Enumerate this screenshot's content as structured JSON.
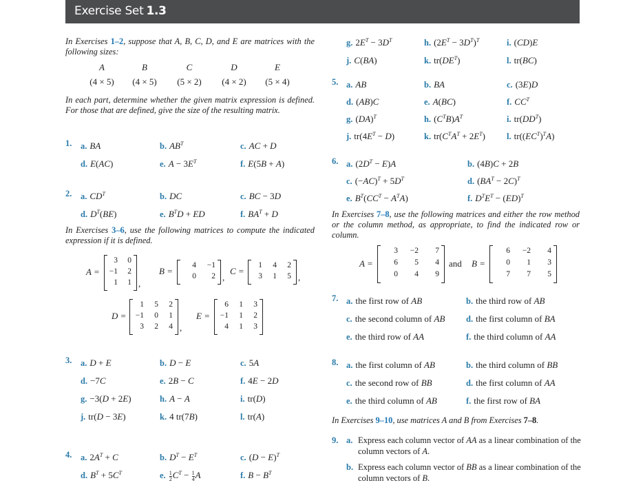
{
  "header": {
    "title": "Exercise Set",
    "number": "1.3"
  },
  "intro_1_2": {
    "prefix": "In Exercises ",
    "ref": "1–2",
    "suffix": ", suppose that A, B, C, D, and E are matrices with the following sizes:"
  },
  "sizes": [
    {
      "name": "A",
      "size": "(4 × 5)"
    },
    {
      "name": "B",
      "size": "(4 × 5)"
    },
    {
      "name": "C",
      "size": "(5 × 2)"
    },
    {
      "name": "D",
      "size": "(4 × 2)"
    },
    {
      "name": "E",
      "size": "(5 × 4)"
    }
  ],
  "instruction_1_2": "In each part, determine whether the given matrix expression is defined. For those that are defined, give the size of the resulting matrix.",
  "exercises": {
    "ex1": {
      "number": "1.",
      "parts": [
        {
          "label": "a.",
          "expr": "BA"
        },
        {
          "label": "b.",
          "expr": "AB^T"
        },
        {
          "label": "c.",
          "expr": "AC + D"
        },
        {
          "label": "d.",
          "expr": "E(AC)"
        },
        {
          "label": "e.",
          "expr": "A − 3E^T"
        },
        {
          "label": "f.",
          "expr": "E(5B + A)"
        }
      ]
    },
    "ex2": {
      "number": "2.",
      "parts": [
        {
          "label": "a.",
          "expr": "CD^T"
        },
        {
          "label": "b.",
          "expr": "DC"
        },
        {
          "label": "c.",
          "expr": "BC − 3D"
        },
        {
          "label": "d.",
          "expr": "D^T(BE)"
        },
        {
          "label": "e.",
          "expr": "B^TD + ED"
        },
        {
          "label": "f.",
          "expr": "BA^T + D"
        }
      ]
    },
    "ex3": {
      "number": "3.",
      "parts": [
        {
          "label": "a.",
          "expr": "D + E"
        },
        {
          "label": "b.",
          "expr": "D − E"
        },
        {
          "label": "c.",
          "expr": "5A"
        },
        {
          "label": "d.",
          "expr": "−7C"
        },
        {
          "label": "e.",
          "expr": "2B − C"
        },
        {
          "label": "f.",
          "expr": "4E − 2D"
        },
        {
          "label": "g.",
          "expr": "−3(D + 2E)"
        },
        {
          "label": "h.",
          "expr": "A − A"
        },
        {
          "label": "i.",
          "expr": "tr(D)"
        },
        {
          "label": "j.",
          "expr": "tr(D − 3E)"
        },
        {
          "label": "k.",
          "expr": "4 tr(7B)"
        },
        {
          "label": "l.",
          "expr": "tr(A)"
        }
      ]
    },
    "ex4": {
      "number": "4.",
      "parts": [
        {
          "label": "a.",
          "expr": "2A^T + C"
        },
        {
          "label": "b.",
          "expr": "D^T − E^T"
        },
        {
          "label": "c.",
          "expr": "(D − E)^T"
        },
        {
          "label": "d.",
          "expr": "B^T + 5C^T"
        },
        {
          "label": "e.",
          "expr": "½C^T − ¼A"
        },
        {
          "label": "f.",
          "expr": "B − B^T"
        },
        {
          "label": "g.",
          "expr": "2E^T − 3D^T"
        },
        {
          "label": "h.",
          "expr": "(2E^T − 3D^T)^T"
        },
        {
          "label": "i.",
          "expr": "(CD)E"
        },
        {
          "label": "j.",
          "expr": "C(BA)"
        },
        {
          "label": "k.",
          "expr": "tr(DE^T)"
        },
        {
          "label": "l.",
          "expr": "tr(BC)"
        }
      ]
    },
    "ex5": {
      "number": "5.",
      "parts": [
        {
          "label": "a.",
          "expr": "AB"
        },
        {
          "label": "b.",
          "expr": "BA"
        },
        {
          "label": "c.",
          "expr": "(3E)D"
        },
        {
          "label": "d.",
          "expr": "(AB)C"
        },
        {
          "label": "e.",
          "expr": "A(BC)"
        },
        {
          "label": "f.",
          "expr": "CC^T"
        },
        {
          "label": "g.",
          "expr": "(DA)^T"
        },
        {
          "label": "h.",
          "expr": "(C^TB)A^T"
        },
        {
          "label": "i.",
          "expr": "tr(DD^T)"
        },
        {
          "label": "j.",
          "expr": "tr(4E^T − D)"
        },
        {
          "label": "k.",
          "expr": "tr(C^TA^T + 2E^T)"
        },
        {
          "label": "l.",
          "expr": "tr((EC^T)^TA)"
        }
      ]
    },
    "ex6": {
      "number": "6.",
      "parts": [
        {
          "label": "a.",
          "expr": "(2D^T − E)A"
        },
        {
          "label": "b.",
          "expr": "(4B)C + 2B"
        },
        {
          "label": "c.",
          "expr": "(−AC)^T + 5D^T"
        },
        {
          "label": "d.",
          "expr": "(BA^T − 2C)^T"
        },
        {
          "label": "e.",
          "expr": "B^T(CC^T − A^TA)"
        },
        {
          "label": "f.",
          "expr": "D^TE^T − (ED)^T"
        }
      ]
    },
    "ex7": {
      "number": "7.",
      "parts": [
        {
          "label": "a.",
          "text": "the first row of ",
          "mat": "AB"
        },
        {
          "label": "b.",
          "text": "the third row of ",
          "mat": "AB"
        },
        {
          "label": "c.",
          "text": "the second column of ",
          "mat": "AB"
        },
        {
          "label": "d.",
          "text": "the first column of ",
          "mat": "BA"
        },
        {
          "label": "e.",
          "text": "the third row of ",
          "mat": "AA"
        },
        {
          "label": "f.",
          "text": "the third column of ",
          "mat": "AA"
        }
      ]
    },
    "ex8": {
      "number": "8.",
      "parts": [
        {
          "label": "a.",
          "text": "the first column of ",
          "mat": "AB"
        },
        {
          "label": "b.",
          "text": "the third column of ",
          "mat": "BB"
        },
        {
          "label": "c.",
          "text": "the second row of ",
          "mat": "BB"
        },
        {
          "label": "d.",
          "text": "the first column of ",
          "mat": "AA"
        },
        {
          "label": "e.",
          "text": "the third column of ",
          "mat": "AB"
        },
        {
          "label": "f.",
          "text": "the first row of ",
          "mat": "BA"
        }
      ]
    },
    "ex9": {
      "number": "9.",
      "parts": [
        {
          "label": "a.",
          "text": "Express each column vector of AA as a linear combination of the column vectors of A."
        },
        {
          "label": "b.",
          "text": "Express each column vector of BB as a linear combination of the column vectors of B."
        }
      ]
    }
  },
  "intro_3_6": {
    "prefix": "In Exercises ",
    "ref": "3–6",
    "suffix": ", use the following matrices to compute the indicated expression if it is defined."
  },
  "matrices_3_6": {
    "A": {
      "name": "A",
      "rows": [
        [
          "3",
          "0"
        ],
        [
          "−1",
          "2"
        ],
        [
          "1",
          "1"
        ]
      ]
    },
    "B": {
      "name": "B",
      "rows": [
        [
          "4",
          "−1"
        ],
        [
          "0",
          "2"
        ]
      ]
    },
    "C": {
      "name": "C",
      "rows": [
        [
          "1",
          "4",
          "2"
        ],
        [
          "3",
          "1",
          "5"
        ]
      ]
    },
    "D": {
      "name": "D",
      "rows": [
        [
          "1",
          "5",
          "2"
        ],
        [
          "−1",
          "0",
          "1"
        ],
        [
          "3",
          "2",
          "4"
        ]
      ]
    },
    "E": {
      "name": "E",
      "rows": [
        [
          "6",
          "1",
          "3"
        ],
        [
          "−1",
          "1",
          "2"
        ],
        [
          "4",
          "1",
          "3"
        ]
      ]
    }
  },
  "intro_7_8": {
    "prefix": "In Exercises ",
    "ref": "7–8",
    "suffix": ", use the following matrices and either the row method or the column method, as appropriate, to find the indicated row or column."
  },
  "matrices_7_8": {
    "connector": "and",
    "A": {
      "name": "A",
      "rows": [
        [
          "3",
          "−2",
          "7"
        ],
        [
          "6",
          "5",
          "4"
        ],
        [
          "0",
          "4",
          "9"
        ]
      ]
    },
    "B": {
      "name": "B",
      "rows": [
        [
          "6",
          "−2",
          "4"
        ],
        [
          "0",
          "1",
          "3"
        ],
        [
          "7",
          "7",
          "5"
        ]
      ]
    }
  },
  "intro_9_10": {
    "prefix": "In Exercises ",
    "ref": "9–10",
    "suffix": ", use matrices A and B from Exercises ",
    "ref2": "7–8",
    "end": "."
  }
}
